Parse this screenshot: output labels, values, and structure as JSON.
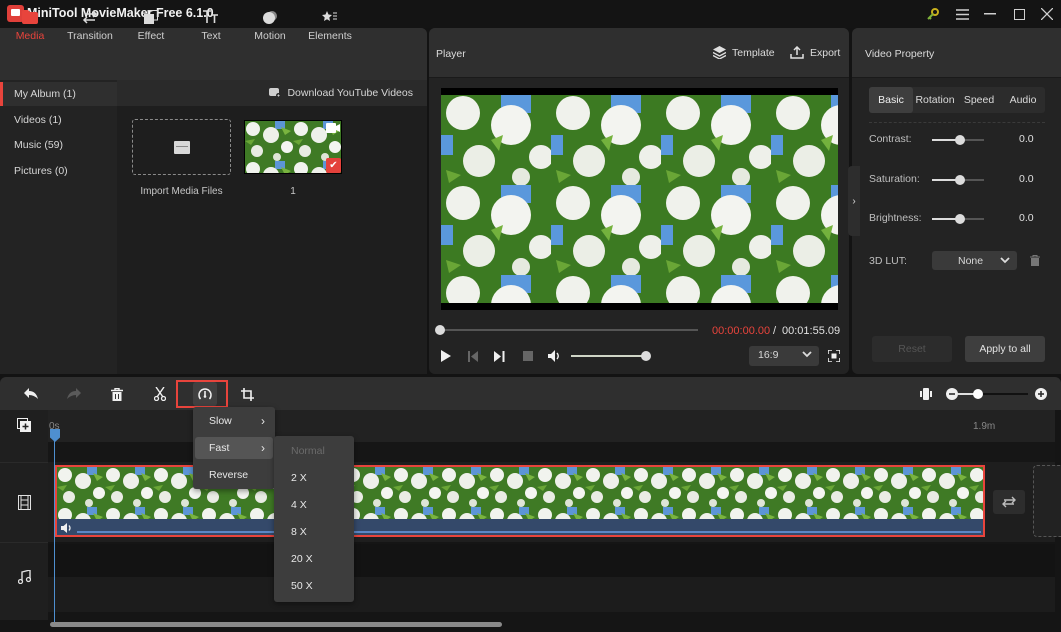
{
  "app": {
    "title": "MiniTool MovieMaker Free 6.1.0",
    "window_controls": [
      "key-icon",
      "menu-icon",
      "minimize-icon",
      "maximize-icon",
      "close-icon"
    ]
  },
  "media_tabs": [
    {
      "label": "Media",
      "icon": "folder-icon",
      "active": true
    },
    {
      "label": "Transition",
      "icon": "swap-arrows-icon",
      "active": false
    },
    {
      "label": "Effect",
      "icon": "effect-layers-icon",
      "active": false
    },
    {
      "label": "Text",
      "icon": "text-icon",
      "active": false
    },
    {
      "label": "Motion",
      "icon": "motion-icon",
      "active": false
    },
    {
      "label": "Elements",
      "icon": "elements-star-icon",
      "active": false
    }
  ],
  "album": {
    "items": [
      {
        "label": "My Album (1)",
        "active": true
      },
      {
        "label": "Videos (1)",
        "active": false
      },
      {
        "label": "Music (59)",
        "active": false
      },
      {
        "label": "Pictures (0)",
        "active": false
      }
    ],
    "download_label": "Download YouTube Videos",
    "import_label": "Import Media Files",
    "thumb_label": "1"
  },
  "player": {
    "title": "Player",
    "template_label": "Template",
    "export_label": "Export",
    "time_current": "00:00:00.00",
    "time_separator": "/",
    "time_total": "00:01:55.09",
    "seek_progress": 0,
    "volume": 1.0,
    "aspect_ratio": "16:9",
    "accent_color": "#e8443c"
  },
  "property": {
    "title": "Video Property",
    "tabs": [
      {
        "label": "Basic",
        "active": true
      },
      {
        "label": "Rotation",
        "active": false
      },
      {
        "label": "Speed",
        "active": false
      },
      {
        "label": "Audio",
        "active": false
      }
    ],
    "sliders": [
      {
        "label": "Contrast:",
        "value": "0.0"
      },
      {
        "label": "Saturation:",
        "value": "0.0"
      },
      {
        "label": "Brightness:",
        "value": "0.0"
      }
    ],
    "lut_label": "3D LUT:",
    "lut_value": "None",
    "reset_label": "Reset",
    "apply_label": "Apply to all"
  },
  "timeline": {
    "toolbar": [
      "undo-icon",
      "redo-icon",
      "delete-icon",
      "split-icon",
      "speed-icon",
      "crop-icon"
    ],
    "ruler_start": "0s",
    "ruler_end": "1.9m",
    "zoom_level": 0.25
  },
  "speed_menu": {
    "items": [
      {
        "label": "Slow",
        "has_submenu": true,
        "hover": false
      },
      {
        "label": "Fast",
        "has_submenu": true,
        "hover": true
      },
      {
        "label": "Reverse",
        "has_submenu": false,
        "hover": false
      }
    ],
    "fast_submenu": [
      {
        "label": "Normal",
        "disabled": true
      },
      {
        "label": "2 X",
        "disabled": false
      },
      {
        "label": "4 X",
        "disabled": false
      },
      {
        "label": "8 X",
        "disabled": false
      },
      {
        "label": "20 X",
        "disabled": false
      },
      {
        "label": "50 X",
        "disabled": false
      }
    ]
  }
}
